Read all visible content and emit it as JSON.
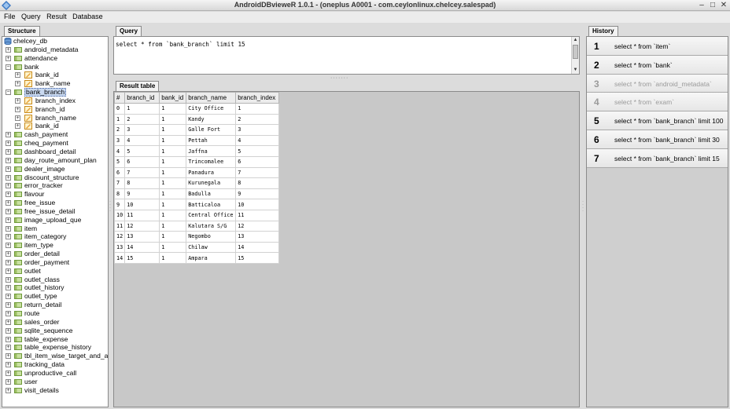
{
  "window": {
    "title": "AndroidDBvieweR 1.0.1 - (oneplus A0001 - com.ceylonlinux.chelcey.salespad)",
    "minimize": "–",
    "maximize": "□",
    "close": "✕"
  },
  "menu": [
    "File",
    "Query",
    "Result",
    "Database"
  ],
  "structure": {
    "tab": "Structure",
    "database": "chelcey_db",
    "tables": [
      {
        "name": "android_metadata",
        "expanded": false
      },
      {
        "name": "attendance",
        "expanded": false
      },
      {
        "name": "bank",
        "expanded": true,
        "columns": [
          "bank_id",
          "bank_name"
        ]
      },
      {
        "name": "bank_branch",
        "expanded": true,
        "selected": true,
        "columns": [
          "branch_index",
          "branch_id",
          "branch_name",
          "bank_id"
        ]
      },
      {
        "name": "cash_payment",
        "expanded": false
      },
      {
        "name": "cheq_payment",
        "expanded": false
      },
      {
        "name": "dashboard_detail",
        "expanded": false
      },
      {
        "name": "day_route_amount_plan",
        "expanded": false
      },
      {
        "name": "dealer_image",
        "expanded": false
      },
      {
        "name": "discount_structure",
        "expanded": false
      },
      {
        "name": "error_tracker",
        "expanded": false
      },
      {
        "name": "flavour",
        "expanded": false
      },
      {
        "name": "free_issue",
        "expanded": false
      },
      {
        "name": "free_issue_detail",
        "expanded": false
      },
      {
        "name": "image_upload_que",
        "expanded": false
      },
      {
        "name": "item",
        "expanded": false
      },
      {
        "name": "item_category",
        "expanded": false
      },
      {
        "name": "item_type",
        "expanded": false
      },
      {
        "name": "order_detail",
        "expanded": false
      },
      {
        "name": "order_payment",
        "expanded": false
      },
      {
        "name": "outlet",
        "expanded": false
      },
      {
        "name": "outlet_class",
        "expanded": false
      },
      {
        "name": "outlet_history",
        "expanded": false
      },
      {
        "name": "outlet_type",
        "expanded": false
      },
      {
        "name": "return_detail",
        "expanded": false
      },
      {
        "name": "route",
        "expanded": false
      },
      {
        "name": "sales_order",
        "expanded": false
      },
      {
        "name": "sqlite_sequence",
        "expanded": false
      },
      {
        "name": "table_expense",
        "expanded": false
      },
      {
        "name": "table_expense_history",
        "expanded": false
      },
      {
        "name": "tbl_item_wise_target_and_a",
        "expanded": false
      },
      {
        "name": "tracking_data",
        "expanded": false
      },
      {
        "name": "unproductive_call",
        "expanded": false
      },
      {
        "name": "user",
        "expanded": false
      },
      {
        "name": "visit_details",
        "expanded": false
      }
    ]
  },
  "query": {
    "tab": "Query",
    "text": "select * from `bank_branch` limit 15"
  },
  "result": {
    "tab": "Result table",
    "columns": [
      "#",
      "branch_id",
      "bank_id",
      "branch_name",
      "branch_index"
    ],
    "rows": [
      [
        "0",
        "1",
        "1",
        "City Office",
        "1"
      ],
      [
        "1",
        "2",
        "1",
        "Kandy",
        "2"
      ],
      [
        "2",
        "3",
        "1",
        "Galle Fort",
        "3"
      ],
      [
        "3",
        "4",
        "1",
        "Pettah",
        "4"
      ],
      [
        "4",
        "5",
        "1",
        "Jaffna",
        "5"
      ],
      [
        "5",
        "6",
        "1",
        "Trincomalee",
        "6"
      ],
      [
        "6",
        "7",
        "1",
        "Panadura",
        "7"
      ],
      [
        "7",
        "8",
        "1",
        "Kurunegala",
        "8"
      ],
      [
        "8",
        "9",
        "1",
        "Badulla",
        "9"
      ],
      [
        "9",
        "10",
        "1",
        "Batticaloa",
        "10"
      ],
      [
        "10",
        "11",
        "1",
        "Central Office",
        "11"
      ],
      [
        "11",
        "12",
        "1",
        "Kalutara S/G",
        "12"
      ],
      [
        "12",
        "13",
        "1",
        "Negombo",
        "13"
      ],
      [
        "13",
        "14",
        "1",
        "Chilaw",
        "14"
      ],
      [
        "14",
        "15",
        "1",
        "Ampara",
        "15"
      ]
    ]
  },
  "history": {
    "tab": "History",
    "items": [
      {
        "num": "1",
        "query": "select * from `item`",
        "active": true
      },
      {
        "num": "2",
        "query": "select * from `bank`",
        "active": true
      },
      {
        "num": "3",
        "query": "select * from `android_metadata`",
        "active": false
      },
      {
        "num": "4",
        "query": "select * from `exam`",
        "active": false
      },
      {
        "num": "5",
        "query": "select * from `bank_branch` limit 100",
        "active": true
      },
      {
        "num": "6",
        "query": "select * from `bank_branch` limit 30",
        "active": true
      },
      {
        "num": "7",
        "query": "select * from `bank_branch` limit 15",
        "active": true
      }
    ]
  }
}
